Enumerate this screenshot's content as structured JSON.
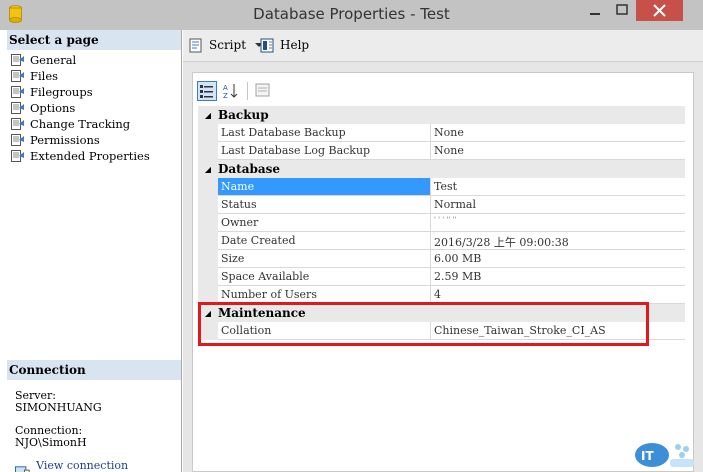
{
  "window": {
    "title": "Database Properties - Test"
  },
  "left": {
    "select_header": "Select a page",
    "pages": [
      {
        "label": "General",
        "icon": "page-icon"
      },
      {
        "label": "Files",
        "icon": "page-icon"
      },
      {
        "label": "Filegroups",
        "icon": "page-icon"
      },
      {
        "label": "Options",
        "icon": "page-icon"
      },
      {
        "label": "Change Tracking",
        "icon": "page-icon"
      },
      {
        "label": "Permissions",
        "icon": "page-icon"
      },
      {
        "label": "Extended Properties",
        "icon": "page-icon"
      }
    ],
    "connection_header": "Connection",
    "server_label": "Server:",
    "server_value": "SIMONHUANG",
    "connection_label": "Connection:",
    "connection_value": "NJO\\SimonH",
    "view_link": "View connection properties"
  },
  "toolbar": {
    "script_label": "Script",
    "help_label": "Help"
  },
  "grid": {
    "categories": [
      {
        "name": "Backup",
        "rows": [
          {
            "name": "Last Database Backup",
            "value": "None"
          },
          {
            "name": "Last Database Log Backup",
            "value": "None"
          }
        ]
      },
      {
        "name": "Database",
        "rows": [
          {
            "name": "Name",
            "value": "Test",
            "selected": true
          },
          {
            "name": "Status",
            "value": "Normal"
          },
          {
            "name": "Owner",
            "value": "' ' ' '' ''"
          },
          {
            "name": "Date Created",
            "value": "2016/3/28 上午 09:00:38"
          },
          {
            "name": "Size",
            "value": "6.00 MB"
          },
          {
            "name": "Space Available",
            "value": "2.59 MB"
          },
          {
            "name": "Number of Users",
            "value": "4"
          }
        ]
      },
      {
        "name": "Maintenance",
        "rows": [
          {
            "name": "Collation",
            "value": "Chinese_Taiwan_Stroke_CI_AS"
          }
        ]
      }
    ]
  },
  "colors": {
    "selection": "#3399ff",
    "highlight_box": "#e0191f",
    "close_button": "#c7504a"
  }
}
